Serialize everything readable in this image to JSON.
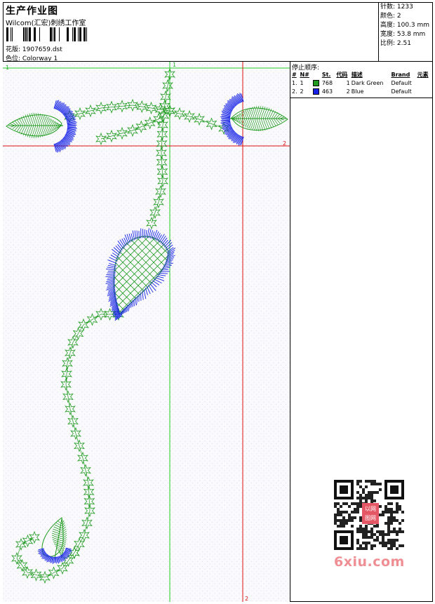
{
  "header": {
    "title": "生产作业图",
    "studio": "Wilcom(汇宏)刺绣工作室",
    "pattern_label": "花版: 1907659.dst",
    "colorway_label": "色位:  Colorway 1"
  },
  "stats": [
    "针数: 1233",
    "颜色: 2",
    "高度: 100.3 mm",
    "宽度: 53.8 mm",
    "比例: 2.51"
  ],
  "guides": {
    "green_top": "1",
    "green_left": "1",
    "red_right": "2",
    "red_bottom": "2"
  },
  "colors": {
    "dark_green": "#1f9a1f",
    "blue": "#1420e6",
    "guide_green": "#22cc22",
    "guide_red": "#dd1010"
  },
  "stop_sequence": {
    "title": "停止顺序:",
    "columns": [
      "#",
      "N#",
      "St.",
      "代码",
      "描述",
      "Brand",
      "元素"
    ],
    "rows": [
      {
        "index": "1.",
        "needle": "1",
        "swatch": "#1f9a1f",
        "stitches": "768",
        "code": "1",
        "description": "Dark Green",
        "brand": "Default",
        "element": ""
      },
      {
        "index": "2.",
        "needle": "2",
        "swatch": "#1420e6",
        "stitches": "463",
        "code": "2",
        "description": "Blue",
        "brand": "Default",
        "element": ""
      }
    ]
  },
  "watermark": {
    "badge_line1": "以网",
    "badge_line2": "图网",
    "site": "6xiu.com"
  }
}
